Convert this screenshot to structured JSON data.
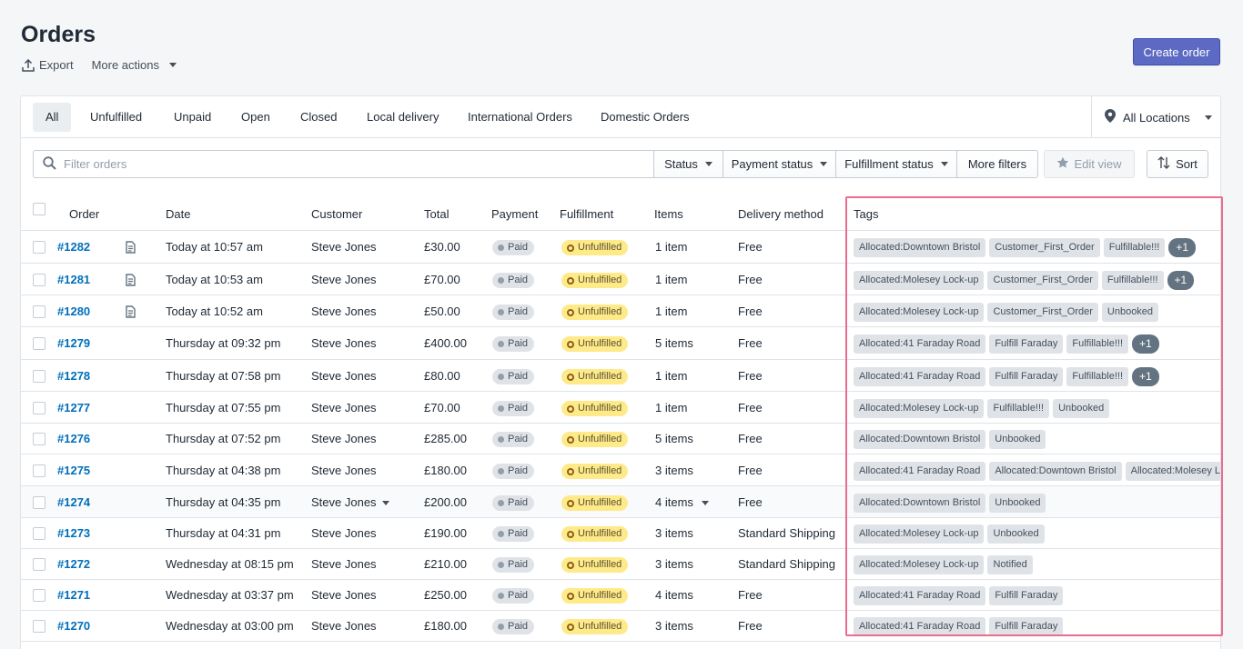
{
  "page": {
    "title": "Orders",
    "export_label": "Export",
    "more_actions_label": "More actions",
    "create_order_label": "Create order"
  },
  "tabs": [
    {
      "label": "All",
      "active": true
    },
    {
      "label": "Unfulfilled"
    },
    {
      "label": "Unpaid"
    },
    {
      "label": "Open"
    },
    {
      "label": "Closed"
    },
    {
      "label": "Local delivery"
    },
    {
      "label": "International Orders"
    },
    {
      "label": "Domestic Orders"
    }
  ],
  "locations": {
    "label": "All Locations"
  },
  "filters": {
    "search_placeholder": "Filter orders",
    "status_label": "Status",
    "payment_status_label": "Payment status",
    "fulfillment_status_label": "Fulfillment status",
    "more_filters_label": "More filters",
    "edit_view_label": "Edit view",
    "sort_label": "Sort"
  },
  "columns": {
    "order": "Order",
    "date": "Date",
    "customer": "Customer",
    "total": "Total",
    "payment": "Payment",
    "fulfillment": "Fulfillment",
    "items": "Items",
    "delivery": "Delivery method",
    "tags": "Tags"
  },
  "orders": [
    {
      "id": "#1282",
      "note": true,
      "date": "Today at 10:57 am",
      "customer": "Steve Jones",
      "total": "£30.00",
      "payment": "Paid",
      "fulfillment": "Unfulfilled",
      "items": "1 item",
      "delivery": "Free",
      "tags": [
        "Allocated:Downtown Bristol",
        "Customer_First_Order",
        "Fulfillable!!!",
        "+1"
      ]
    },
    {
      "id": "#1281",
      "note": true,
      "date": "Today at 10:53 am",
      "customer": "Steve Jones",
      "total": "£70.00",
      "payment": "Paid",
      "fulfillment": "Unfulfilled",
      "items": "1 item",
      "delivery": "Free",
      "tags": [
        "Allocated:Molesey Lock-up",
        "Customer_First_Order",
        "Fulfillable!!!",
        "+1"
      ]
    },
    {
      "id": "#1280",
      "note": true,
      "date": "Today at 10:52 am",
      "customer": "Steve Jones",
      "total": "£50.00",
      "payment": "Paid",
      "fulfillment": "Unfulfilled",
      "items": "1 item",
      "delivery": "Free",
      "tags": [
        "Allocated:Molesey Lock-up",
        "Customer_First_Order",
        "Unbooked"
      ]
    },
    {
      "id": "#1279",
      "note": false,
      "date": "Thursday at 09:32 pm",
      "customer": "Steve Jones",
      "total": "£400.00",
      "payment": "Paid",
      "fulfillment": "Unfulfilled",
      "items": "5 items",
      "delivery": "Free",
      "tags": [
        "Allocated:41 Faraday Road",
        "Fulfill Faraday",
        "Fulfillable!!!",
        "+1"
      ]
    },
    {
      "id": "#1278",
      "note": false,
      "date": "Thursday at 07:58 pm",
      "customer": "Steve Jones",
      "total": "£80.00",
      "payment": "Paid",
      "fulfillment": "Unfulfilled",
      "items": "1 item",
      "delivery": "Free",
      "tags": [
        "Allocated:41 Faraday Road",
        "Fulfill Faraday",
        "Fulfillable!!!",
        "+1"
      ]
    },
    {
      "id": "#1277",
      "note": false,
      "date": "Thursday at 07:55 pm",
      "customer": "Steve Jones",
      "total": "£70.00",
      "payment": "Paid",
      "fulfillment": "Unfulfilled",
      "items": "1 item",
      "delivery": "Free",
      "tags": [
        "Allocated:Molesey Lock-up",
        "Fulfillable!!!",
        "Unbooked"
      ]
    },
    {
      "id": "#1276",
      "note": false,
      "date": "Thursday at 07:52 pm",
      "customer": "Steve Jones",
      "total": "£285.00",
      "payment": "Paid",
      "fulfillment": "Unfulfilled",
      "items": "5 items",
      "delivery": "Free",
      "tags": [
        "Allocated:Downtown Bristol",
        "Unbooked"
      ]
    },
    {
      "id": "#1275",
      "note": false,
      "date": "Thursday at 04:38 pm",
      "customer": "Steve Jones",
      "total": "£180.00",
      "payment": "Paid",
      "fulfillment": "Unfulfilled",
      "items": "3 items",
      "delivery": "Free",
      "tags": [
        "Allocated:41 Faraday Road",
        "Allocated:Downtown Bristol",
        "Allocated:Molesey Lock-up"
      ]
    },
    {
      "id": "#1274",
      "note": false,
      "hover": true,
      "date": "Thursday at 04:35 pm",
      "customer": "Steve Jones",
      "total": "£200.00",
      "payment": "Paid",
      "fulfillment": "Unfulfilled",
      "items": "4 items",
      "delivery": "Free",
      "tags": [
        "Allocated:Downtown Bristol",
        "Unbooked"
      ]
    },
    {
      "id": "#1273",
      "note": false,
      "date": "Thursday at 04:31 pm",
      "customer": "Steve Jones",
      "total": "£190.00",
      "payment": "Paid",
      "fulfillment": "Unfulfilled",
      "items": "3 items",
      "delivery": "Standard Shipping",
      "tags": [
        "Allocated:Molesey Lock-up",
        "Unbooked"
      ]
    },
    {
      "id": "#1272",
      "note": false,
      "date": "Wednesday at 08:15 pm",
      "customer": "Steve Jones",
      "total": "£210.00",
      "payment": "Paid",
      "fulfillment": "Unfulfilled",
      "items": "3 items",
      "delivery": "Standard Shipping",
      "tags": [
        "Allocated:Molesey Lock-up",
        "Notified"
      ]
    },
    {
      "id": "#1271",
      "note": false,
      "date": "Wednesday at 03:37 pm",
      "customer": "Steve Jones",
      "total": "£250.00",
      "payment": "Paid",
      "fulfillment": "Unfulfilled",
      "items": "4 items",
      "delivery": "Free",
      "tags": [
        "Allocated:41 Faraday Road",
        "Fulfill Faraday"
      ]
    },
    {
      "id": "#1270",
      "note": false,
      "date": "Wednesday at 03:00 pm",
      "customer": "Steve Jones",
      "total": "£180.00",
      "payment": "Paid",
      "fulfillment": "Unfulfilled",
      "items": "3 items",
      "delivery": "Free",
      "tags": [
        "Allocated:41 Faraday Road",
        "Fulfill Faraday"
      ]
    }
  ]
}
